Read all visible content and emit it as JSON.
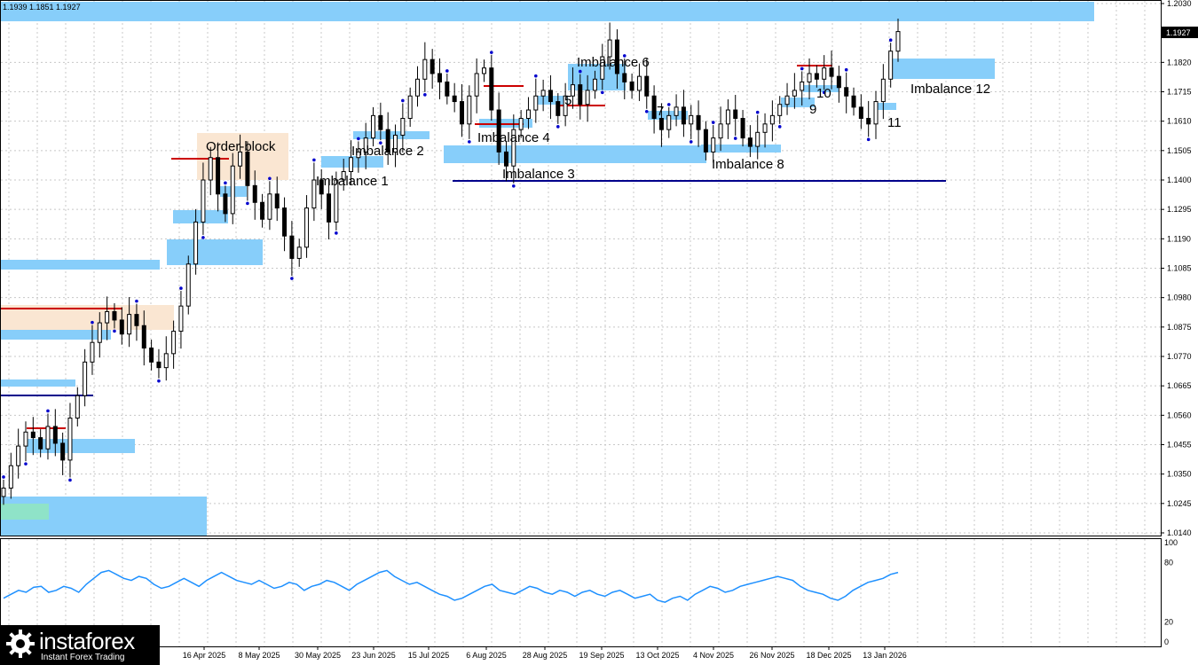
{
  "header": {
    "ohlc": "1.1939 1.1851 1.1927"
  },
  "price_axis": {
    "ticks": [
      "1.2030",
      "1.1820",
      "1.1715",
      "1.1610",
      "1.1505",
      "1.1400",
      "1.1295",
      "1.1190",
      "1.1085",
      "1.0980",
      "1.0875",
      "1.0770",
      "1.0665",
      "1.0560",
      "1.0455",
      "1.0350",
      "1.0245",
      "1.0140"
    ],
    "current_price": "1.1927"
  },
  "indicator_axis": {
    "ticks": [
      "100",
      "80",
      "20",
      "0"
    ]
  },
  "time_axis": {
    "labels": [
      "16 Apr 2025",
      "8 May 2025",
      "30 May 2025",
      "23 Jun 2025",
      "15 Jul 2025",
      "6 Aug 2025",
      "28 Aug 2025",
      "19 Sep 2025",
      "13 Oct 2025",
      "4 Nov 2025",
      "26 Nov 2025",
      "18 Dec 2025",
      "13 Jan 2026"
    ]
  },
  "annotations": {
    "order_block": "Order-block",
    "imb1": "Imbalance 1",
    "imb2": "Imbalance 2",
    "imb3": "Imbalance 3",
    "imb4": "Imbalance 4",
    "imb5": "5",
    "imb6": "Imbalance 6",
    "imb7": "7",
    "imb8": "Imbalance 8",
    "imb9": "9",
    "imb10": "10",
    "imb11": "11",
    "imb12": "Imbalance 12"
  },
  "logo": {
    "name": "instaforex",
    "tagline": "Instant Forex Trading",
    "icon": "gear-logo-icon"
  },
  "colors": {
    "imbalance_zone": "#87cefa",
    "order_block_zone": "#fae6d2",
    "level_red": "#cc0000",
    "level_blue": "#00008b",
    "oscillator": "#1e90ff",
    "fractal_marker": "#0000cd",
    "candle": "#000000"
  },
  "chart_data": {
    "type": "candlestick",
    "symbol_price_range": [
      1.014,
      1.203
    ],
    "closes": [
      1.03,
      1.038,
      1.045,
      1.05,
      1.048,
      1.044,
      1.052,
      1.046,
      1.04,
      1.055,
      1.063,
      1.075,
      1.082,
      1.089,
      1.093,
      1.09,
      1.085,
      1.092,
      1.088,
      1.08,
      1.075,
      1.073,
      1.078,
      1.086,
      1.095,
      1.11,
      1.125,
      1.14,
      1.148,
      1.135,
      1.128,
      1.145,
      1.15,
      1.138,
      1.132,
      1.126,
      1.135,
      1.13,
      1.12,
      1.112,
      1.116,
      1.13,
      1.14,
      1.135,
      1.125,
      1.14,
      1.143,
      1.148,
      1.15,
      1.155,
      1.163,
      1.158,
      1.15,
      1.156,
      1.162,
      1.17,
      1.176,
      1.183,
      1.178,
      1.175,
      1.17,
      1.168,
      1.16,
      1.17,
      1.178,
      1.18,
      1.165,
      1.15,
      1.145,
      1.158,
      1.162,
      1.165,
      1.17,
      1.172,
      1.168,
      1.163,
      1.17,
      1.174,
      1.167,
      1.172,
      1.176,
      1.184,
      1.19,
      1.178,
      1.175,
      1.172,
      1.177,
      1.17,
      1.162,
      1.158,
      1.163,
      1.166,
      1.16,
      1.163,
      1.158,
      1.15,
      1.155,
      1.16,
      1.165,
      1.162,
      1.155,
      1.152,
      1.157,
      1.16,
      1.163,
      1.167,
      1.17,
      1.172,
      1.175,
      1.178,
      1.176,
      1.18,
      1.177,
      1.173,
      1.17,
      1.166,
      1.162,
      1.16,
      1.168,
      1.176,
      1.186,
      1.193
    ],
    "rsi_values": [
      44,
      48,
      52,
      50,
      55,
      56,
      50,
      52,
      56,
      54,
      50,
      58,
      64,
      70,
      72,
      68,
      64,
      62,
      66,
      64,
      58,
      54,
      56,
      60,
      64,
      60,
      56,
      62,
      66,
      70,
      66,
      62,
      60,
      58,
      62,
      58,
      54,
      56,
      60,
      58,
      52,
      56,
      58,
      62,
      60,
      56,
      52,
      58,
      62,
      66,
      70,
      72,
      66,
      62,
      58,
      60,
      56,
      52,
      48,
      46,
      42,
      44,
      48,
      52,
      56,
      58,
      52,
      50,
      48,
      52,
      56,
      54,
      50,
      48,
      52,
      50,
      46,
      50,
      52,
      48,
      46,
      50,
      52,
      48,
      44,
      46,
      48,
      42,
      40,
      44,
      46,
      42,
      48,
      52,
      56,
      54,
      50,
      52,
      56,
      58,
      60,
      62,
      64,
      66,
      64,
      62,
      56,
      52,
      50,
      48,
      44,
      42,
      46,
      52,
      56,
      60,
      62,
      64,
      68,
      70
    ],
    "rsi_range": [
      0,
      100
    ]
  }
}
